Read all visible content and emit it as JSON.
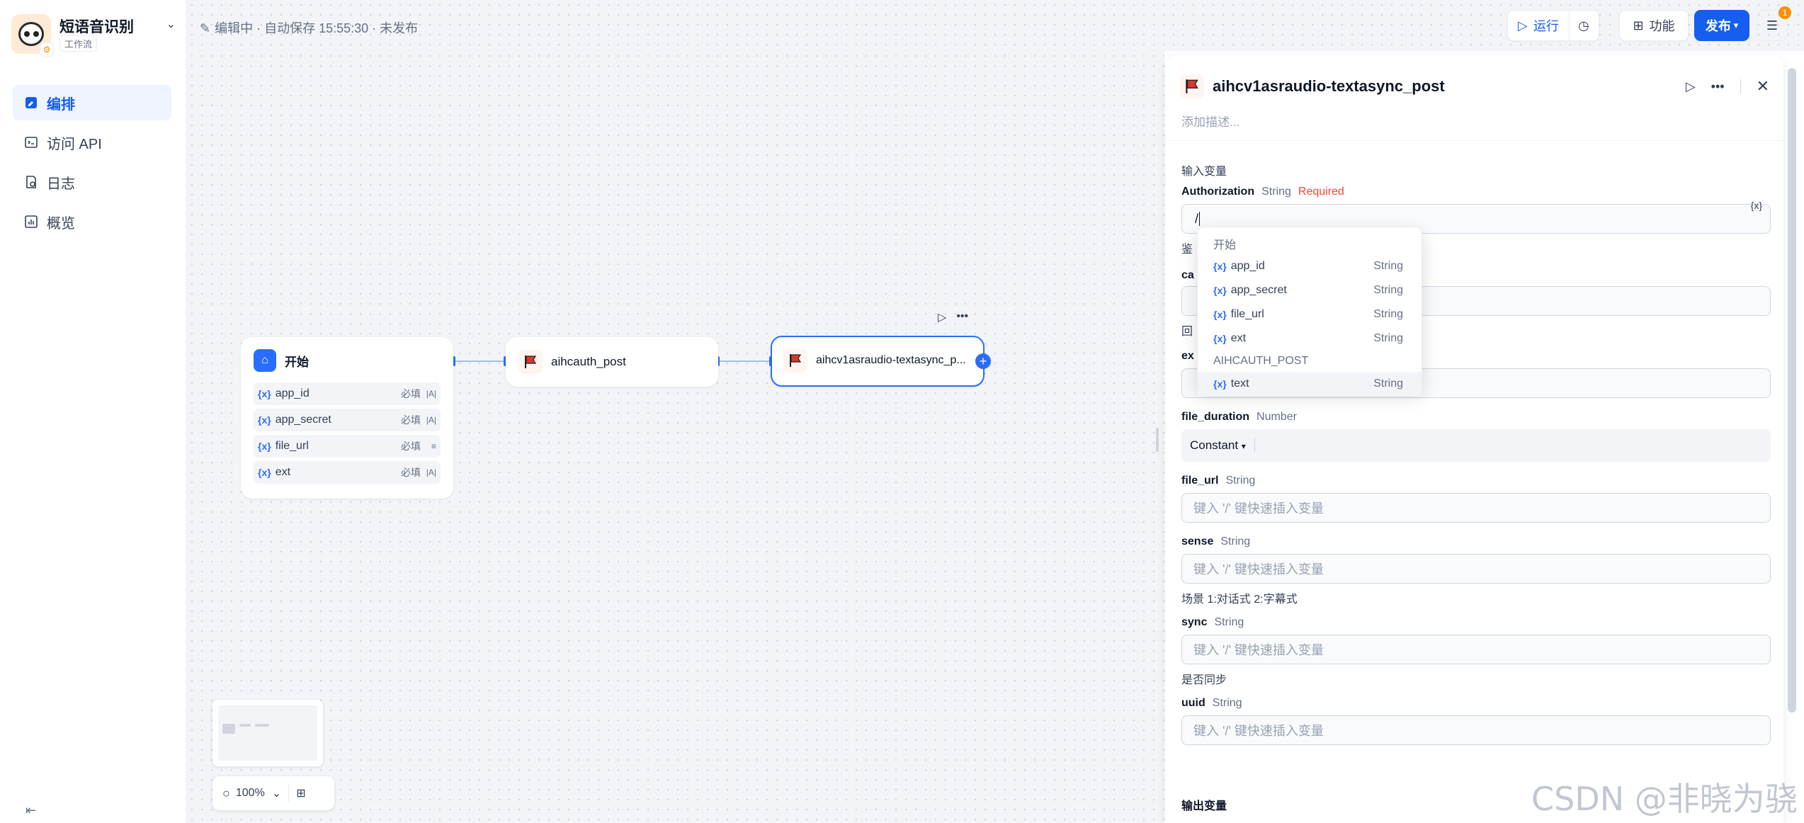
{
  "app": {
    "name": "短语音识别",
    "type": "工作流"
  },
  "nav": [
    {
      "label": "编排",
      "icon": "orchestrate-icon",
      "active": true
    },
    {
      "label": "访问 API",
      "icon": "terminal-icon",
      "active": false
    },
    {
      "label": "日志",
      "icon": "log-icon",
      "active": false
    },
    {
      "label": "概览",
      "icon": "chart-icon",
      "active": false
    }
  ],
  "topbar": {
    "status": "编辑中 · 自动保存 15:55:30 · 未发布",
    "run_label": "运行",
    "features_label": "功能",
    "publish_label": "发布",
    "checklist_count": "1"
  },
  "canvas": {
    "start_node": {
      "title": "开始",
      "vars": [
        {
          "name": "app_id",
          "req": "必填"
        },
        {
          "name": "app_secret",
          "req": "必填"
        },
        {
          "name": "file_url",
          "req": "必填"
        },
        {
          "name": "ext",
          "req": "必填"
        }
      ]
    },
    "auth_node": {
      "title": "aihcauth_post"
    },
    "asr_node": {
      "title": "aihcv1asraudio-textasync_p..."
    },
    "zoom": "100%"
  },
  "panel": {
    "title": "aihcv1asraudio-textasync_post",
    "desc_placeholder": "添加描述...",
    "input_section": "输入变量",
    "output_section": "输出变量",
    "fields": {
      "authorization": {
        "name": "Authorization",
        "type": "String",
        "required": "Required",
        "value": "/",
        "hint_fragment": "鉴"
      },
      "callback": {
        "name_fragment": "ca",
        "hint_fragment": "回"
      },
      "ext": {
        "name_fragment": "ex"
      },
      "file_duration": {
        "name": "file_duration",
        "type": "Number",
        "mode": "Constant"
      },
      "file_url": {
        "name": "file_url",
        "type": "String",
        "placeholder": "键入 '/' 键快速插入变量"
      },
      "sense": {
        "name": "sense",
        "type": "String",
        "placeholder": "键入 '/' 键快速插入变量",
        "hint": "场景 1:对话式 2:字幕式"
      },
      "sync": {
        "name": "sync",
        "type": "String",
        "placeholder": "键入 '/' 键快速插入变量",
        "hint": "是否同步"
      },
      "uuid": {
        "name": "uuid",
        "type": "String",
        "placeholder": "键入 '/' 键快速插入变量"
      }
    }
  },
  "dropdown": {
    "groups": [
      {
        "title": "开始",
        "items": [
          {
            "name": "app_id",
            "type": "String"
          },
          {
            "name": "app_secret",
            "type": "String"
          },
          {
            "name": "file_url",
            "type": "String"
          },
          {
            "name": "ext",
            "type": "String"
          }
        ]
      },
      {
        "title": "AIHCAUTH_POST",
        "items": [
          {
            "name": "text",
            "type": "String"
          }
        ]
      }
    ]
  },
  "watermark": "CSDN @非晓为骁"
}
